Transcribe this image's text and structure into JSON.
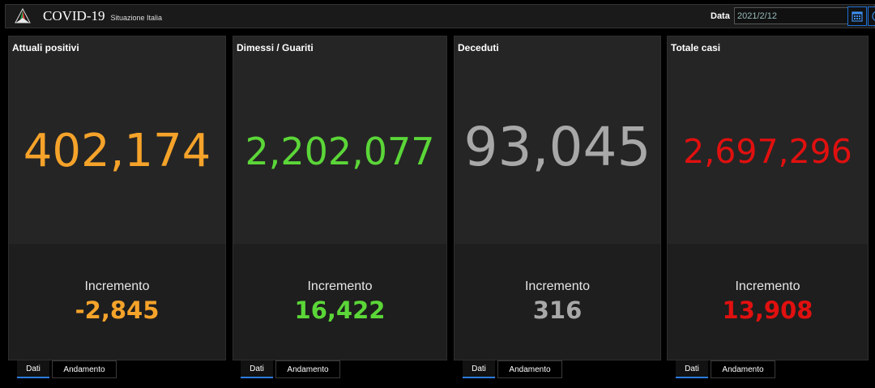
{
  "header": {
    "title": "COVID-19",
    "subtitle": "Situazione Italia",
    "date_label": "Data",
    "date_value": "2021/2/12",
    "calendar_icon": "calendar-icon",
    "clock_icon": "clock-icon"
  },
  "colors": {
    "positivi": "#f5a32a",
    "guariti": "#5bd638",
    "deceduti": "#a8a8a8",
    "totale": "#e0100f",
    "accent": "#2a7be0"
  },
  "panels": [
    {
      "title": "Attuali positivi",
      "value": "402,174",
      "increment_label": "Incremento",
      "increment": "-2,845"
    },
    {
      "title": "Dimessi / Guariti",
      "value": "2,202,077",
      "increment_label": "Incremento",
      "increment": "16,422"
    },
    {
      "title": "Deceduti",
      "value": "93,045",
      "increment_label": "Incremento",
      "increment": "316"
    },
    {
      "title": "Totale casi",
      "value": "2,697,296",
      "increment_label": "Incremento",
      "increment": "13,908"
    }
  ],
  "tabs": {
    "dati": "Dati",
    "andamento": "Andamento"
  }
}
